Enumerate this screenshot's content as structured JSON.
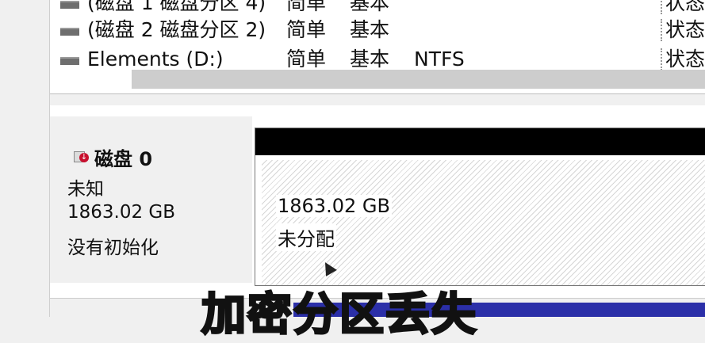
{
  "volume_list": {
    "rows": [
      {
        "name": "(磁盘 1 磁盘分区 4)",
        "layout": "简单",
        "type": "基本",
        "fs": "",
        "status": "状态"
      },
      {
        "name": "(磁盘 2 磁盘分区 2)",
        "layout": "简单",
        "type": "基本",
        "fs": "",
        "status": "状态"
      },
      {
        "name": "Elements (D:)",
        "layout": "简单",
        "type": "基本",
        "fs": "NTFS",
        "status": "状态"
      }
    ]
  },
  "disk": {
    "title": "磁盘 0",
    "type": "未知",
    "size": "1863.02 GB",
    "state": "没有初始化"
  },
  "partition": {
    "size": "1863.02 GB",
    "state": "未分配"
  },
  "caption": "加密分区丢失",
  "icons": [
    "drive-icon",
    "disk-offline-icon",
    "mouse-cursor-icon"
  ]
}
